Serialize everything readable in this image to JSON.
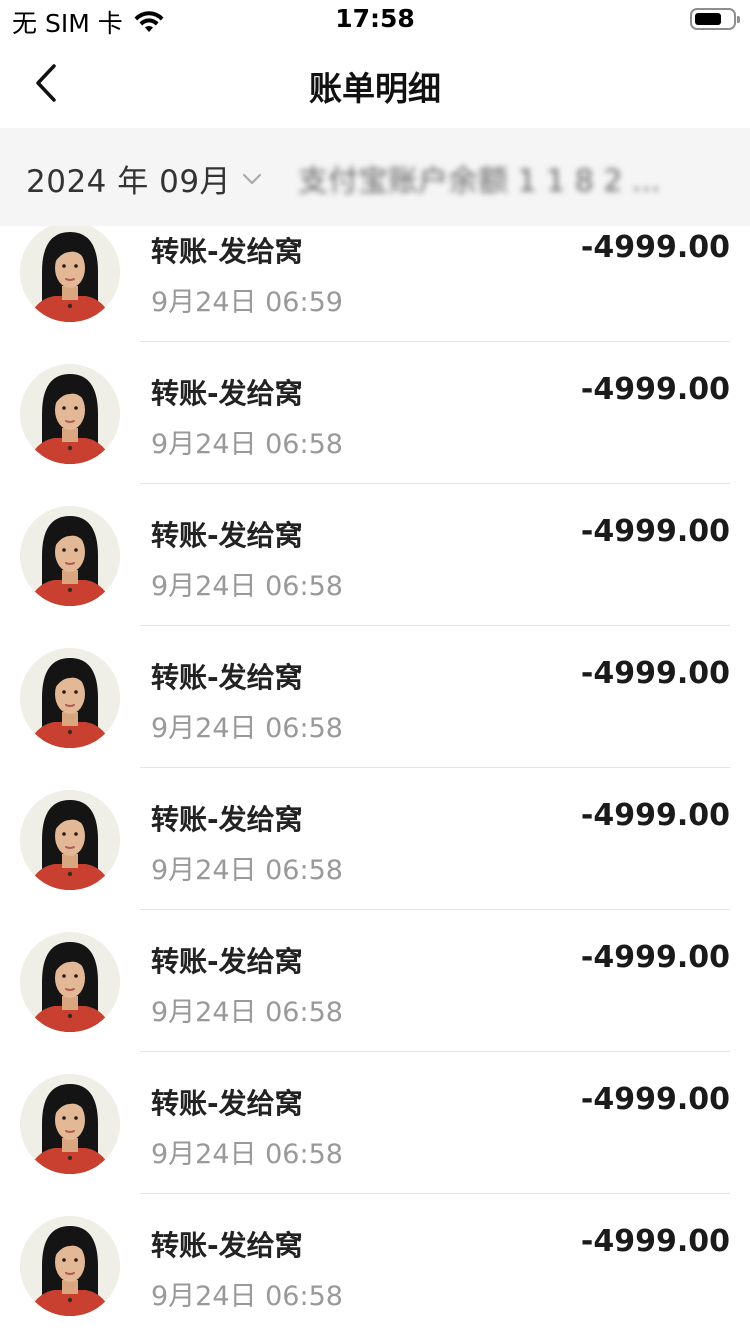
{
  "status_bar": {
    "carrier": "无 SIM 卡",
    "time": "17:58"
  },
  "nav": {
    "title": "账单明细"
  },
  "filter": {
    "month": "2024 年 09月",
    "account": "支付宝账户余额 1 1 8 2 ..."
  },
  "transactions": [
    {
      "title": "转账-发给窝",
      "time": "9月24日 06:59",
      "amount": "-4999.00"
    },
    {
      "title": "转账-发给窝",
      "time": "9月24日 06:58",
      "amount": "-4999.00"
    },
    {
      "title": "转账-发给窝",
      "time": "9月24日 06:58",
      "amount": "-4999.00"
    },
    {
      "title": "转账-发给窝",
      "time": "9月24日 06:58",
      "amount": "-4999.00"
    },
    {
      "title": "转账-发给窝",
      "time": "9月24日 06:58",
      "amount": "-4999.00"
    },
    {
      "title": "转账-发给窝",
      "time": "9月24日 06:58",
      "amount": "-4999.00"
    },
    {
      "title": "转账-发给窝",
      "time": "9月24日 06:58",
      "amount": "-4999.00"
    },
    {
      "title": "转账-发给窝",
      "time": "9月24日 06:58",
      "amount": "-4999.00"
    }
  ],
  "icons": {
    "back": "chevron-left-icon",
    "month_dropdown": "chevron-down-icon",
    "wifi": "wifi-icon",
    "battery": "battery-icon",
    "avatar": "avatar-portrait"
  }
}
